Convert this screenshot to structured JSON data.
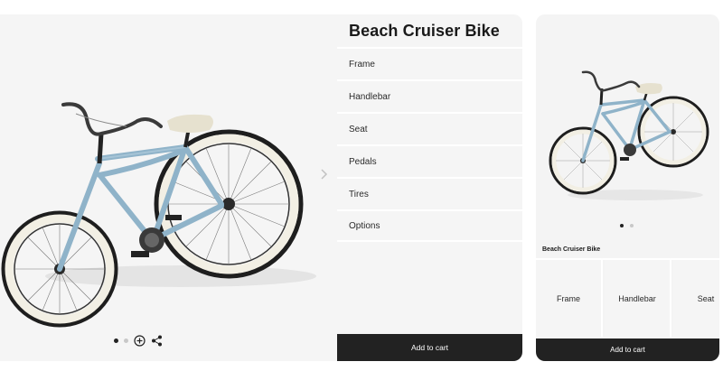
{
  "desktop": {
    "product_title": "Beach Cruiser Bike",
    "options": [
      "Frame",
      "Handlebar",
      "Seat",
      "Pedals",
      "Tires",
      "Options"
    ],
    "add_to_cart_label": "Add to cart",
    "carousel": {
      "total": 2,
      "active": 1
    },
    "controls": [
      "zoom-in-icon",
      "share-icon"
    ],
    "nav_icon": "chevron-right-icon"
  },
  "mobile": {
    "product_title": "Beach Cruiser Bike",
    "tiles": [
      "Frame",
      "Handlebar",
      "Seat"
    ],
    "add_to_cart_label": "Add to cart",
    "carousel": {
      "total": 2,
      "active": 1
    }
  },
  "colors": {
    "frame": "#8fb3c9",
    "tire_wall": "#f2efe4",
    "seat": "#e6e1cf",
    "button": "#222222",
    "card_bg": "#f4f4f4"
  }
}
